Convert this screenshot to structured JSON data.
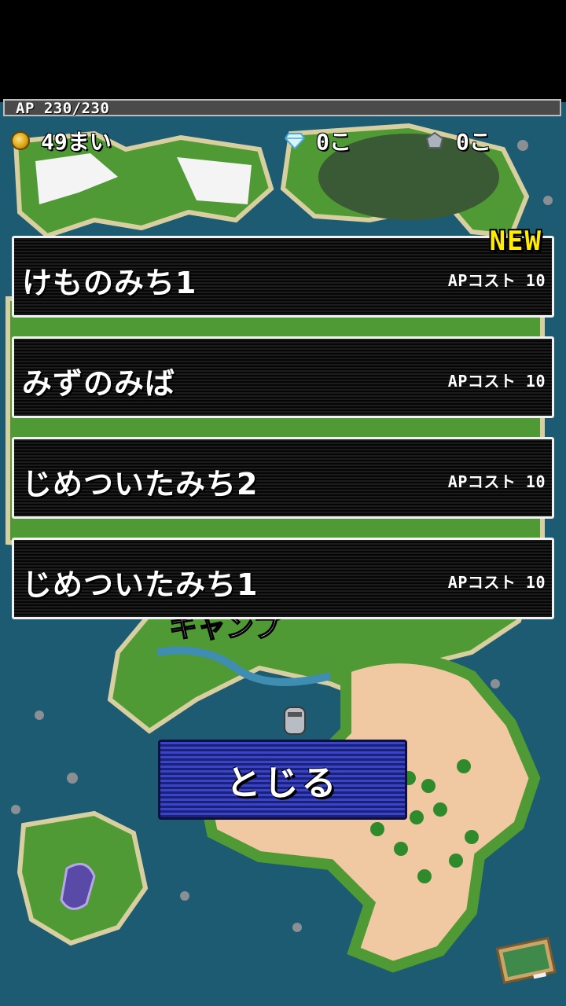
{
  "status": {
    "ap_text": "AP 230/230",
    "ap_current": 230,
    "ap_max": 230,
    "coins": "49まい",
    "gems": "0こ",
    "ores": "0こ"
  },
  "stages": [
    {
      "name": "けものみち1",
      "cost": "APコスト 10",
      "badge": "NEW"
    },
    {
      "name": "みずのみば",
      "cost": "APコスト 10"
    },
    {
      "name": "じめついたみち2",
      "cost": "APコスト 10"
    },
    {
      "name": "じめついたみち1",
      "cost": "APコスト 10"
    }
  ],
  "map": {
    "label": "キャンプ"
  },
  "close_label": "とじる",
  "icons": {
    "coin": "coin-icon",
    "gem": "diamond-icon",
    "ore": "ore-icon",
    "memo": "chalkboard-icon"
  },
  "colors": {
    "sea": "#1d5b72",
    "grass": "#4f9a34",
    "sand": "#f0c8a2",
    "new_badge": "#ffec00",
    "close_button": "#2b33a6"
  }
}
